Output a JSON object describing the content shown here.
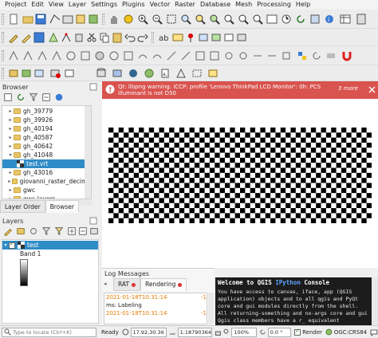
{
  "menubar": {
    "items": [
      "Project",
      "Edit",
      "View",
      "Layer",
      "Settings",
      "Plugins",
      "Vector",
      "Raster",
      "Database",
      "Mesh",
      "Processing",
      "Help"
    ]
  },
  "browser_panel": {
    "title": "Browser",
    "items": [
      {
        "label": "gh_39779",
        "selected": false,
        "expanded": false,
        "type": "folder"
      },
      {
        "label": "gh_39926",
        "selected": false,
        "expanded": false,
        "type": "folder"
      },
      {
        "label": "gh_40194",
        "selected": false,
        "expanded": false,
        "type": "folder"
      },
      {
        "label": "gh_40587",
        "selected": false,
        "expanded": false,
        "type": "folder"
      },
      {
        "label": "gh_40642",
        "selected": false,
        "expanded": false,
        "type": "folder"
      },
      {
        "label": "gh_41048",
        "selected": false,
        "expanded": true,
        "type": "folder"
      },
      {
        "label": "test.vrt",
        "selected": true,
        "expanded": false,
        "type": "raster"
      },
      {
        "label": "gh_43016",
        "selected": false,
        "expanded": false,
        "type": "folder"
      },
      {
        "label": "giovanni_raster_decimal",
        "selected": false,
        "expanded": false,
        "type": "folder"
      },
      {
        "label": "gwc",
        "selected": false,
        "expanded": false,
        "type": "folder"
      },
      {
        "label": "gwc-layers",
        "selected": false,
        "expanded": false,
        "type": "folder"
      }
    ],
    "tabs": [
      "Layer Order",
      "Browser"
    ],
    "active_tab": "Browser"
  },
  "layers_panel": {
    "title": "Layers",
    "layer_name": "test",
    "legend_label": "Band 1"
  },
  "message_bar": {
    "text": "Qt: libpng warning: iCCP: profile 'Lenovo ThinkPad LCD Monitor': 0h: PCS illuminant is not D50",
    "more": "3 more"
  },
  "log_panel": {
    "title": "Log Messages",
    "tabs": [
      "RAT",
      "Rendering"
    ],
    "active_tab": "Rendering",
    "entries": [
      {
        "time": "2021-01-18T10:31:14",
        "level": "WARNING",
        "text": "-1"
      },
      {
        "time": "",
        "level": "",
        "text": "ms: Labeling"
      },
      {
        "time": "2021-01-18T10:31:14",
        "level": "WARNING",
        "text": "-1"
      }
    ]
  },
  "python_console": {
    "title_prefix": "Welcome to QGIS ",
    "title_link": "IPython",
    "title_suffix": " Console",
    "body": "You have access to canvas, iface, app (QGIS application) objects and to all qgis and PyQt core and gui modules directly from the shell. All returning-something and no-args core and gui Qgis class members have a r_ equivalent"
  },
  "statusbar": {
    "search_placeholder": "Type to locate (Ctrl+K)",
    "ready": "Ready",
    "coordinate": "17.92,30.36",
    "scale": "1:18790364",
    "magnifier": "100%",
    "rotation": "0.0 °",
    "render_label": "Render",
    "crs": "OGC:CRS84"
  },
  "colors": {
    "accent_selection": "#308cc6",
    "message_bar_bg": "#d9534f",
    "console_bg": "#1c1c1c",
    "warning_text": "#e07b00",
    "link_blue": "#5da5ff"
  }
}
